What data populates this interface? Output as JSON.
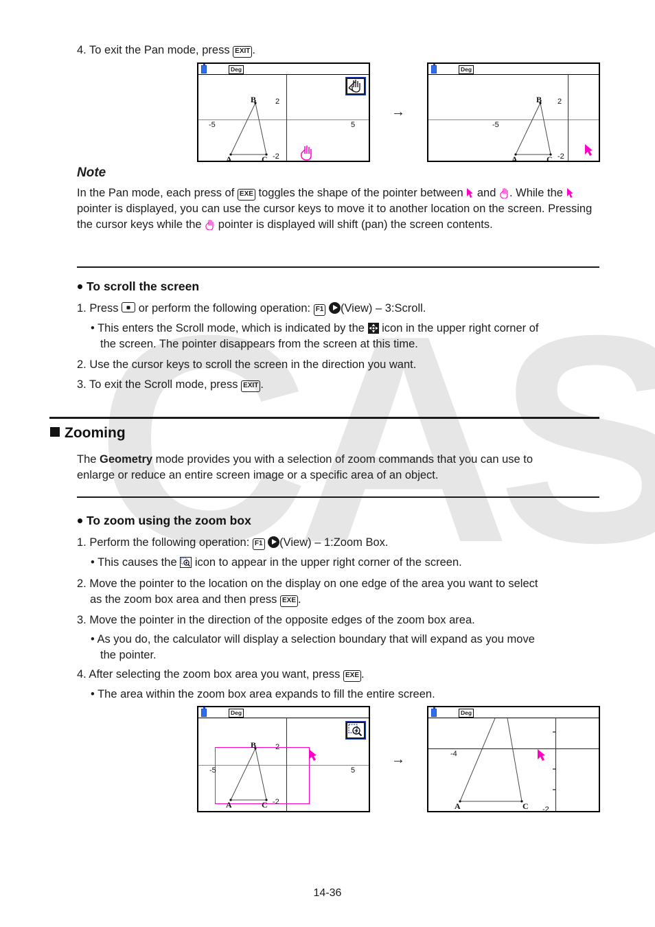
{
  "document": {
    "page_number": "14-36"
  },
  "watermark": {
    "text": "CASIO"
  },
  "step_pan_exit": {
    "prefix": "4. To exit the Pan mode, press",
    "key": "EXIT",
    "suffix": "."
  },
  "note": {
    "heading": "Note",
    "line1_a": "In the Pan mode, each press of",
    "key_exe": "EXE",
    "line1_b": "toggles the shape of the pointer between",
    "line1_c": "and",
    "line1_d": ". While",
    "line2_a": "the",
    "line2_b": "pointer is displayed, you can use the cursor keys to move it to another location on the",
    "line3_a": "screen. Pressing the cursor keys while the",
    "line3_b": "pointer is displayed will shift (pan) the screen",
    "line4": "contents."
  },
  "scroll_section": {
    "heading": "To scroll the screen",
    "step1_a": "1. Press",
    "key_dot": "dot-key",
    "step1_b": "or perform the following operation:",
    "key_f1": "F1",
    "key_right": "right-cursor-key",
    "step1_c": "(View) – 3:Scroll.",
    "bullet1_a": "• This enters the Scroll mode, which is indicated by the",
    "bullet1_icon": "scroll-icon",
    "bullet1_b": "icon in the upper right corner of",
    "bullet1_c": "the screen. The pointer disappears from the screen at this time.",
    "step2": "2. Use the cursor keys to scroll the screen in the direction you want.",
    "step3_a": "3. To exit the Scroll mode, press",
    "key_exit": "EXIT",
    "step3_b": "."
  },
  "zooming_section": {
    "heading": "Zooming",
    "body_a": "The",
    "body_bold": "Geometry",
    "body_b": "mode provides you with a selection of zoom commands that you can use to",
    "body_c": "enlarge or reduce an entire screen image or a specific area of an object."
  },
  "zoombox_section": {
    "heading": "To zoom using the zoom box",
    "step1_a": "1. Perform the following operation:",
    "key_f1": "F1",
    "key_right": "right-cursor-key",
    "step1_b": "(View) – 1:Zoom Box.",
    "bullet1_a": "• This causes the",
    "bullet1_icon": "zoom-box-icon",
    "bullet1_b": "icon to appear in the upper right corner of the screen.",
    "step2_a": "2. Move the pointer to the location on the display on one edge of the area you want to select",
    "step2_b": "as the zoom box area and then press",
    "key_exe": "EXE",
    "step2_c": ".",
    "step3": "3. Move the pointer in the direction of the opposite edges of the zoom box area.",
    "bullet2_a": "• As you do, the calculator will display a selection boundary that will expand as you move",
    "bullet2_b": "the pointer.",
    "step4_a": "4. After selecting the zoom box area you want, press",
    "key_exe2": "EXE",
    "step4_b": ".",
    "bullet3": "• The area within the zoom box area expands to fill the entire screen."
  },
  "colors": {
    "pointer_pink": "#ff00c8",
    "selection_magenta": "#ff00c8",
    "battery_blue": "#2f6fe8",
    "icon_outline_blue": "#2040c0",
    "axis_gray": "#8a8a8a",
    "watermark_gray": "#e6e6e6"
  },
  "screens": {
    "pan_before": {
      "status_mode": "Deg",
      "mode_icon": "pan-hand-icon",
      "tick_labels": [
        "-5",
        "2",
        "5",
        "-2"
      ],
      "point_labels": [
        "A",
        "B",
        "C"
      ],
      "pointer": "hand-pointer"
    },
    "pan_after": {
      "status_mode": "Deg",
      "tick_labels": [
        "-5",
        "2",
        "-2"
      ],
      "point_labels": [
        "A",
        "B",
        "C"
      ],
      "pointer": "arrow-pointer"
    },
    "zoom_before": {
      "status_mode": "Deg",
      "mode_icon": "zoom-box-icon",
      "tick_labels": [
        "-5",
        "2",
        "5",
        "-2"
      ],
      "point_labels": [
        "A",
        "B",
        "C"
      ],
      "pointer": "arrow-pointer",
      "selection_box": "magenta-rectangle"
    },
    "zoom_after": {
      "status_mode": "Deg",
      "tick_labels": [
        "-4",
        "-2"
      ],
      "point_labels": [
        "A",
        "C"
      ],
      "pointer": "arrow-pointer"
    },
    "transition_arrow": "→"
  }
}
